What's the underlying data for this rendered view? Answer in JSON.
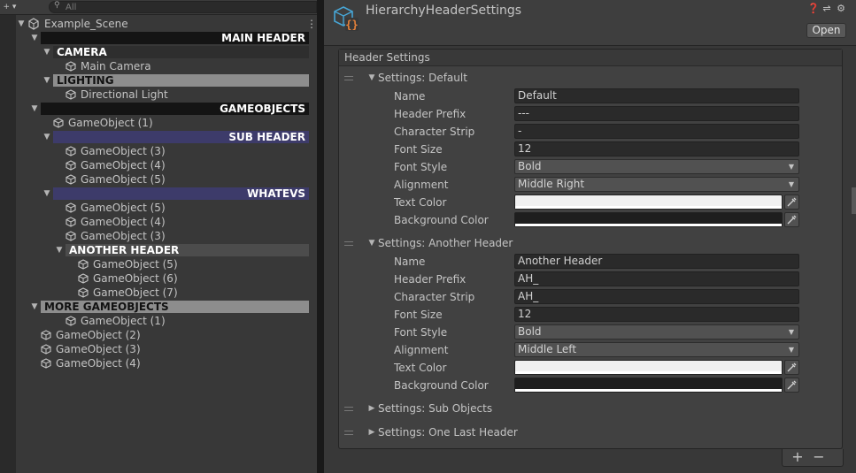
{
  "hierarchy": {
    "search": {
      "placeholder": "All",
      "value": ""
    },
    "scene_name": "Example_Scene",
    "rows": [
      {
        "kind": "header",
        "style": "black",
        "indent": 1,
        "expanded": true,
        "label": "MAIN HEADER"
      },
      {
        "kind": "header",
        "style": "gray",
        "indent": 2,
        "expanded": true,
        "label": "CAMERA"
      },
      {
        "kind": "object",
        "indent": 3,
        "label": "Main Camera"
      },
      {
        "kind": "header",
        "style": "light",
        "indent": 2,
        "expanded": true,
        "label": "LIGHTING"
      },
      {
        "kind": "object",
        "indent": 3,
        "label": "Directional Light"
      },
      {
        "kind": "header",
        "style": "black",
        "indent": 1,
        "expanded": true,
        "label": "GAMEOBJECTS"
      },
      {
        "kind": "object",
        "indent": 2,
        "label": "GameObject (1)"
      },
      {
        "kind": "header",
        "style": "purple",
        "indent": 2,
        "expanded": true,
        "label": "SUB HEADER"
      },
      {
        "kind": "object",
        "indent": 3,
        "label": "GameObject (3)"
      },
      {
        "kind": "object",
        "indent": 3,
        "label": "GameObject (4)"
      },
      {
        "kind": "object",
        "indent": 3,
        "label": "GameObject (5)"
      },
      {
        "kind": "header",
        "style": "purple",
        "indent": 2,
        "expanded": true,
        "label": "WHATEVS"
      },
      {
        "kind": "object",
        "indent": 3,
        "label": "GameObject (5)"
      },
      {
        "kind": "object",
        "indent": 3,
        "label": "GameObject (4)"
      },
      {
        "kind": "object",
        "indent": 3,
        "label": "GameObject (3)"
      },
      {
        "kind": "header",
        "style": "mid",
        "indent": 3,
        "expanded": true,
        "label": "ANOTHER HEADER"
      },
      {
        "kind": "object",
        "indent": 4,
        "label": "GameObject (5)"
      },
      {
        "kind": "object",
        "indent": 4,
        "label": "GameObject (6)"
      },
      {
        "kind": "object",
        "indent": 4,
        "label": "GameObject (7)"
      },
      {
        "kind": "header",
        "style": "light",
        "indent": 1,
        "expanded": true,
        "label": "MORE GAMEOBJECTS"
      },
      {
        "kind": "object",
        "indent": 3,
        "label": "GameObject (1)"
      },
      {
        "kind": "object",
        "indent": 1,
        "label": "GameObject (2)"
      },
      {
        "kind": "object",
        "indent": 1,
        "label": "GameObject (3)"
      },
      {
        "kind": "object",
        "indent": 1,
        "label": "GameObject (4)"
      }
    ]
  },
  "inspector": {
    "title": "HierarchyHeaderSettings",
    "open_label": "Open",
    "icons": [
      "help-icon",
      "preset-icon",
      "settings-icon"
    ],
    "list_title": "Header Settings",
    "labels": {
      "name": "Name",
      "prefix": "Header Prefix",
      "strip": "Character Strip",
      "font_size": "Font Size",
      "font_style": "Font Style",
      "alignment": "Alignment",
      "text_color": "Text Color",
      "bg_color": "Background Color"
    },
    "sections": [
      {
        "title": "Settings: Default",
        "expanded": true,
        "name": "Default",
        "prefix": "---",
        "strip": "-",
        "font_size": "12",
        "font_style": "Bold",
        "alignment": "Middle Right",
        "text_color": "#f0f0f0",
        "bg_color": "#1e1e1e"
      },
      {
        "title": "Settings: Another Header",
        "expanded": true,
        "name": "Another Header",
        "prefix": "AH_",
        "strip": "AH_",
        "font_size": "12",
        "font_style": "Bold",
        "alignment": "Middle Left",
        "text_color": "#f0f0f0",
        "bg_color": "#1e1e1e"
      },
      {
        "title": "Settings: Sub Objects",
        "expanded": false
      },
      {
        "title": "Settings: One Last Header",
        "expanded": false
      }
    ],
    "footer": {
      "add": "+",
      "remove": "−"
    }
  },
  "colors": {
    "panel_bg": "#383838",
    "field_bg": "#2a2a2a",
    "header_black": "#141414",
    "header_purple": "#3d3b6a",
    "header_light": "#8d8d8d",
    "header_gray": "#2e2e2e",
    "header_mid": "#4c4c4c",
    "cube_icon": "#c4c4c4",
    "asset_icon_blue": "#47a6d6",
    "asset_icon_orange": "#e8823a"
  }
}
